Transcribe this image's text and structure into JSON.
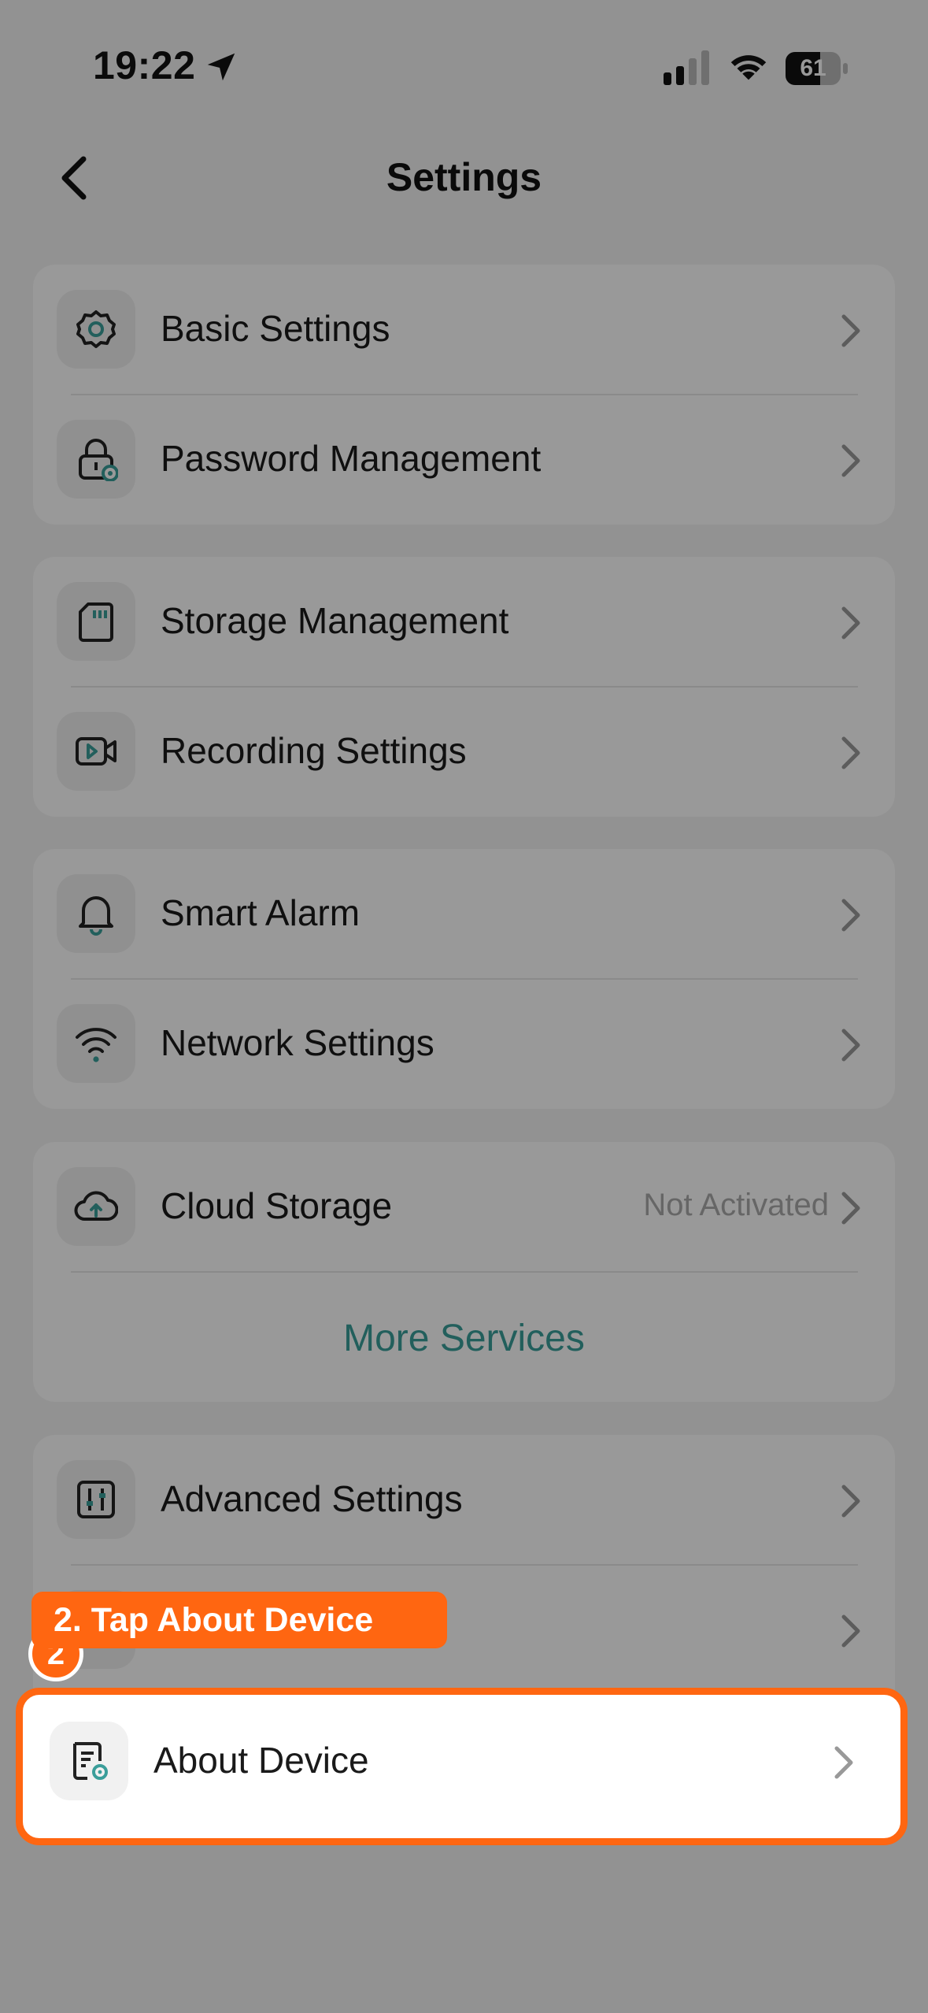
{
  "status_bar": {
    "time": "19:22",
    "battery": "61",
    "icons": [
      "location-arrow-icon",
      "cellular-signal-icon",
      "wifi-icon",
      "battery-icon"
    ]
  },
  "header": {
    "title": "Settings",
    "back_icon": "chevron-left-icon"
  },
  "groups": [
    {
      "items": [
        {
          "label": "Basic Settings",
          "icon": "gear-icon"
        },
        {
          "label": "Password Management",
          "icon": "lock-gear-icon"
        }
      ]
    },
    {
      "items": [
        {
          "label": "Storage Management",
          "icon": "sd-card-icon"
        },
        {
          "label": "Recording Settings",
          "icon": "video-camera-icon"
        }
      ]
    },
    {
      "items": [
        {
          "label": "Smart Alarm",
          "icon": "bell-icon"
        },
        {
          "label": "Network Settings",
          "icon": "wifi-icon"
        }
      ]
    },
    {
      "items": [
        {
          "label": "Cloud Storage",
          "icon": "cloud-upload-icon",
          "value": "Not Activated"
        }
      ],
      "link": "More Services"
    },
    {
      "items": [
        {
          "label": "Advanced Settings",
          "icon": "sliders-icon"
        },
        {
          "label": "",
          "icon": ""
        }
      ]
    },
    {
      "items": [
        {
          "label": "About Device",
          "icon": "document-gear-icon"
        }
      ]
    }
  ],
  "tutorial": {
    "callout": "2. Tap About Device",
    "step": "2"
  },
  "colors": {
    "accent": "#3a9e9a",
    "highlight": "#ff6611",
    "overlay": "rgba(0,0,0,0.40)"
  }
}
